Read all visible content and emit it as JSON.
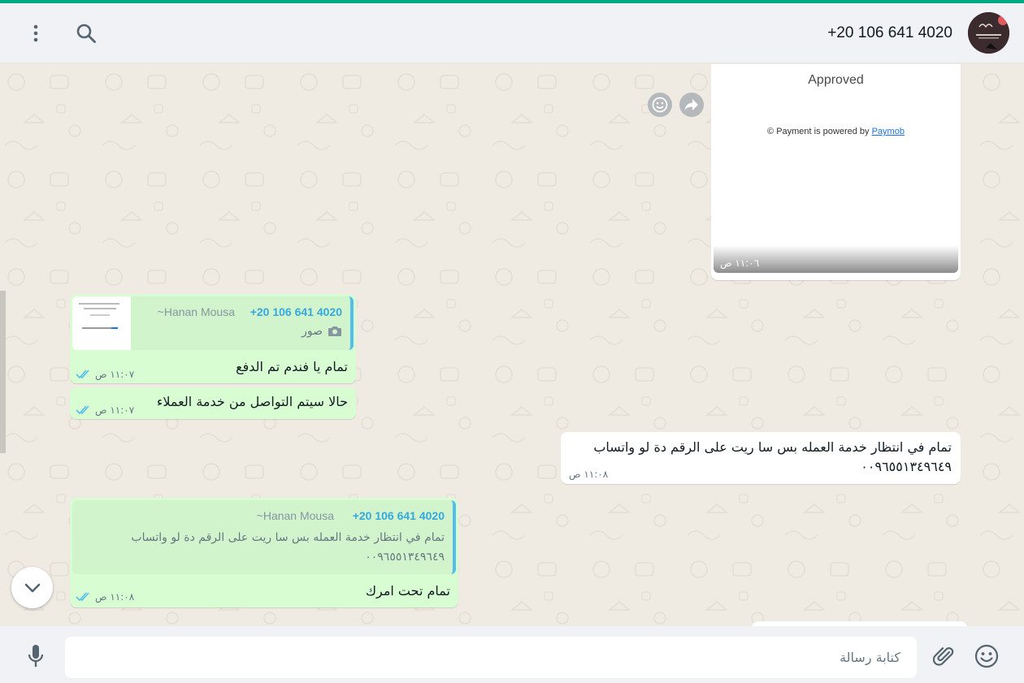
{
  "header": {
    "contact_name": "+20 106 641 4020",
    "avatar_icon": "contact-avatar",
    "search_icon": "search-icon",
    "menu_icon": "menu-dots-icon"
  },
  "messages": {
    "payment_card": {
      "status": "Approved",
      "powered_prefix": "© Payment is powered by",
      "powered_link": "Paymob",
      "time": "١١:٠٦ ص"
    },
    "reply1": {
      "quote_phone": "+20 106 641 4020",
      "quote_name": "~Hanan Mousa",
      "quote_media": "صور",
      "text": "تمام يا فندم تم الدفع",
      "time": "١١:٠٧ ص"
    },
    "msg2": {
      "text": "حالا سيتم التواصل من خدمة العملاء",
      "time": "١١:٠٧ ص"
    },
    "incoming": {
      "line1": "تمام في انتظار خدمة العمله بس سا ريت على الرقم دة لو واتساب",
      "line2": "٠٠٩٦٥٥١٣٤٩٦٤٩",
      "time": "١١:٠٨ ص"
    },
    "reply2": {
      "quote_phone": "+20 106 641 4020",
      "quote_name": "~Hanan Mousa",
      "quote_line1": "تمام في انتظار خدمة العمله بس سا ريت على الرقم دة لو واتساب",
      "quote_line2": "٠٠٩٦٥٥١٣٤٩٦٤٩",
      "text": "تمام تحت امرك",
      "time": "١١:٠٨ ص"
    }
  },
  "footer": {
    "placeholder": "كتابة رسالة",
    "emoji_icon": "emoji-icon",
    "attach_icon": "attach-icon",
    "mic_icon": "mic-icon"
  },
  "colors": {
    "accent": "#00a884",
    "outgoing_bubble": "#d9fdd3",
    "incoming_bubble": "#ffffff",
    "read_ticks": "#53bdeb"
  }
}
